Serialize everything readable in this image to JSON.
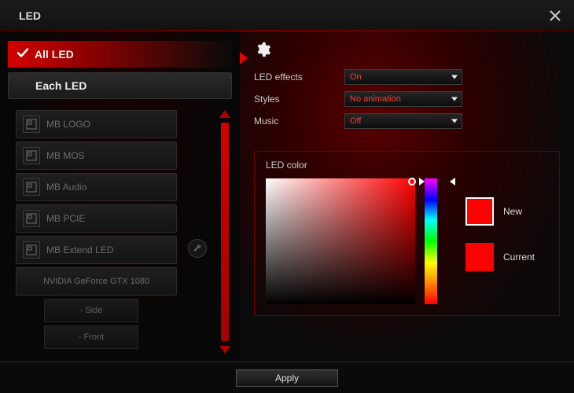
{
  "window": {
    "title": "LED"
  },
  "tabs": {
    "all": "All LED",
    "each": "Each LED"
  },
  "devices": [
    {
      "label": "MB LOGO",
      "kind": "mb"
    },
    {
      "label": "MB MOS",
      "kind": "mb"
    },
    {
      "label": "MB Audio",
      "kind": "mb"
    },
    {
      "label": "MB PCIE",
      "kind": "mb"
    },
    {
      "label": "MB Extend LED",
      "kind": "mb"
    }
  ],
  "gpu": {
    "label": "NVIDIA GeForce GTX 1080"
  },
  "gpu_sub": [
    {
      "label": "- Side"
    },
    {
      "label": "- Front"
    }
  ],
  "settings": {
    "led_effects": {
      "label": "LED effects",
      "value": "On"
    },
    "styles": {
      "label": "Styles",
      "value": "No animation"
    },
    "music": {
      "label": "Music",
      "value": "Off"
    }
  },
  "color_panel": {
    "title": "LED color",
    "new_label": "New",
    "current_label": "Current",
    "new_color": "#ff0000",
    "current_color": "#ff0000"
  },
  "footer": {
    "apply": "Apply"
  }
}
